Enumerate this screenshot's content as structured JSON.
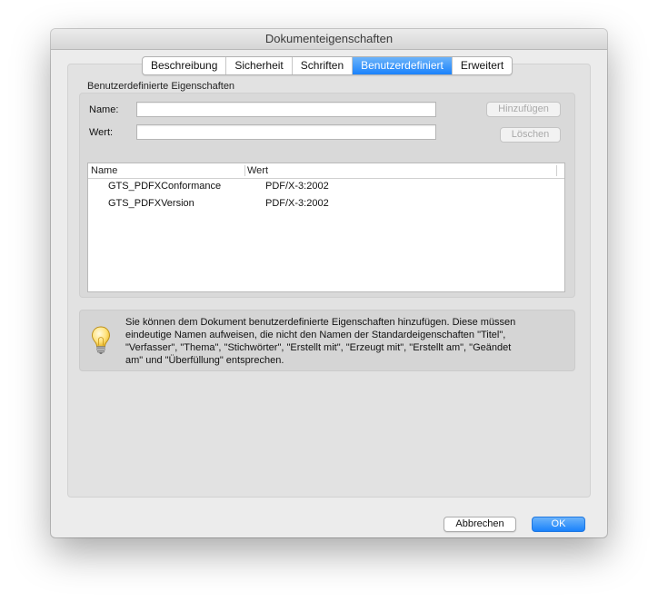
{
  "window": {
    "title": "Dokumenteigenschaften"
  },
  "tabs": [
    {
      "label": "Beschreibung",
      "active": false
    },
    {
      "label": "Sicherheit",
      "active": false
    },
    {
      "label": "Schriften",
      "active": false
    },
    {
      "label": "Benutzerdefiniert",
      "active": true
    },
    {
      "label": "Erweitert",
      "active": false
    }
  ],
  "section_label": "Benutzerdefinierte Eigenschaften",
  "form": {
    "name_label": "Name:",
    "name_value": "",
    "value_label": "Wert:",
    "value_value": "",
    "add_button": "Hinzufügen",
    "delete_button": "Löschen"
  },
  "table": {
    "columns": [
      "Name",
      "Wert"
    ],
    "rows": [
      {
        "name": "GTS_PDFXConformance",
        "value": "PDF/X-3:2002"
      },
      {
        "name": "GTS_PDFXVersion",
        "value": "PDF/X-3:2002"
      }
    ]
  },
  "info": {
    "icon": "lightbulb-icon",
    "lines": [
      "Sie können dem Dokument benutzerdefinierte Eigenschaften hinzufügen. Diese müssen",
      "eindeutige Namen aufweisen, die nicht den Namen der Standardeigenschaften \"Titel\",",
      "\"Verfasser\", \"Thema\", \"Stichwörter\", \"Erstellt mit\", \"Erzeugt mit\", \"Erstellt am\",  \"Geändet",
      "am\" und \"Überfüllung\" entsprechen."
    ]
  },
  "buttons": {
    "cancel": "Abbrechen",
    "ok": "OK"
  },
  "colors": {
    "accent": "#1a82fb",
    "window_bg": "#ececec"
  }
}
